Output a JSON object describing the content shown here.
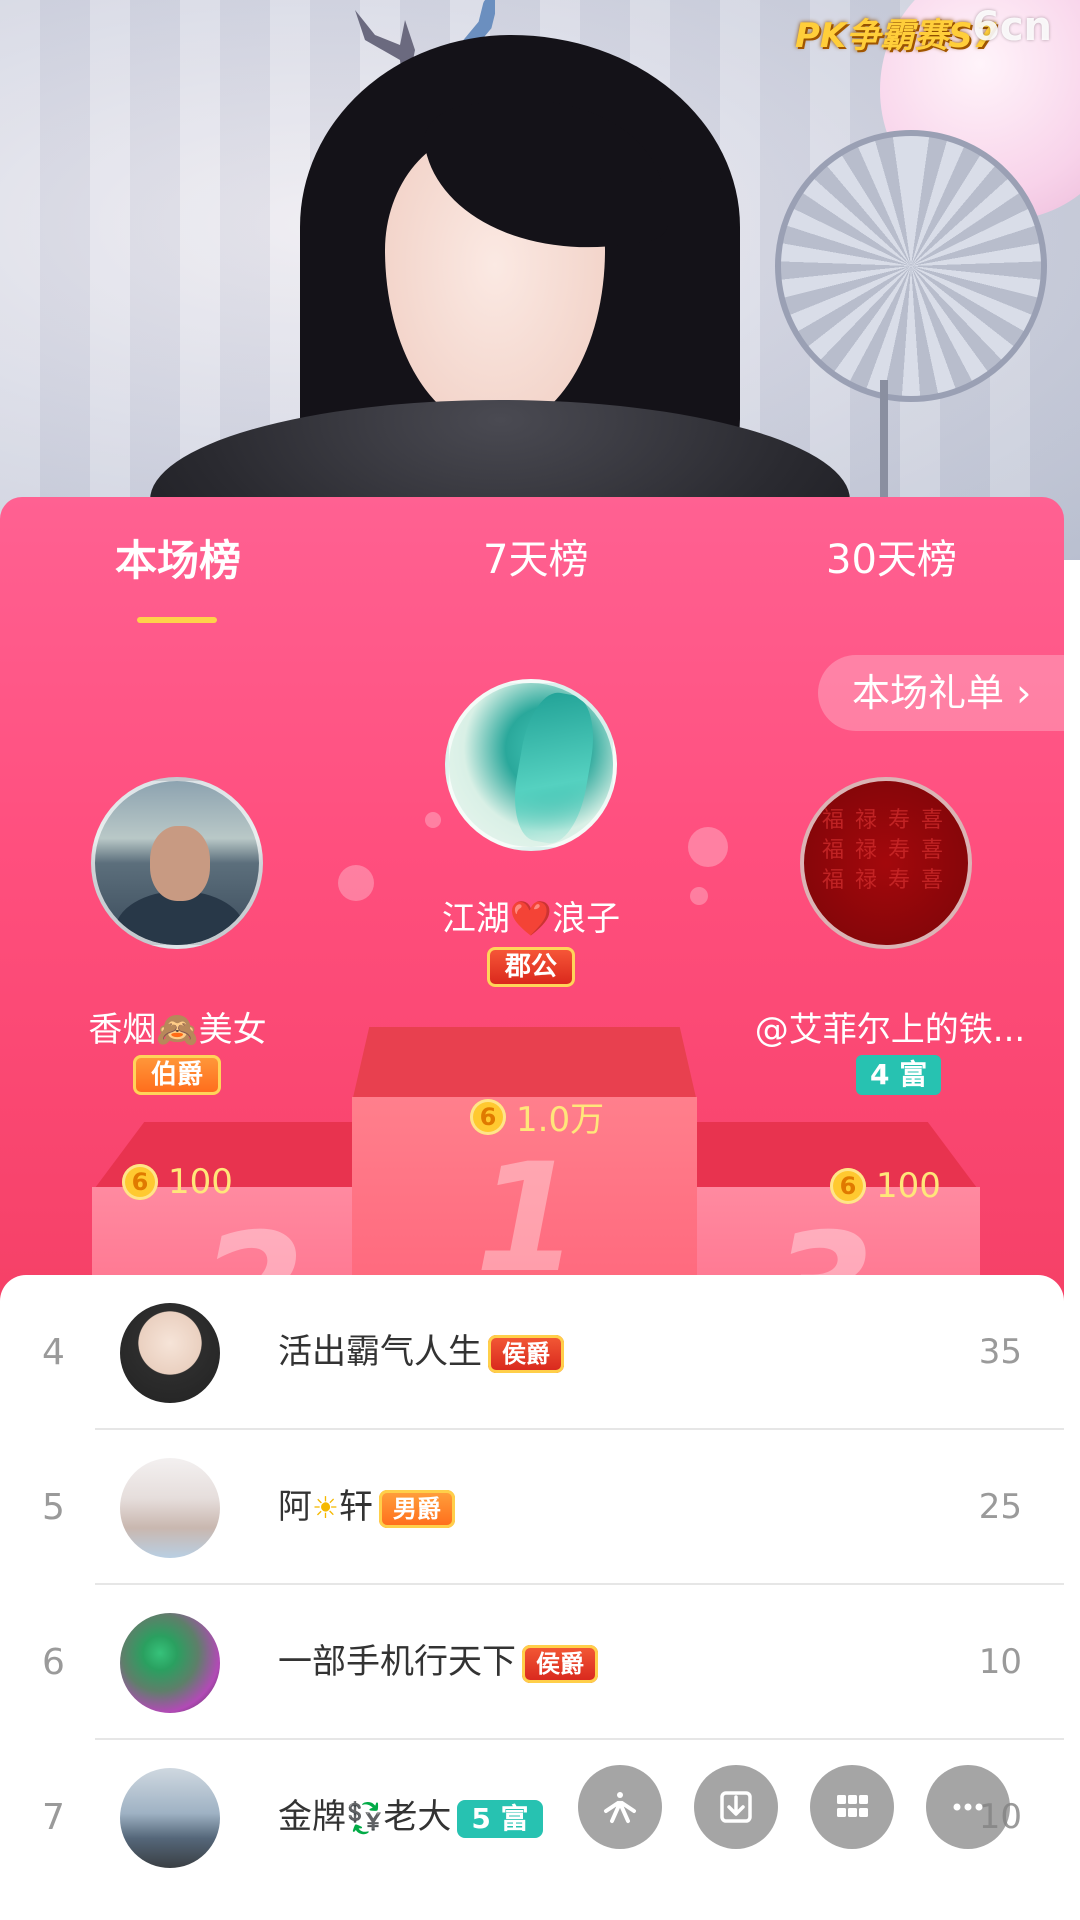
{
  "video": {
    "logo_event": "PK争霸赛S7",
    "logo_brand": "6cn"
  },
  "tabs": [
    {
      "label": "本场榜",
      "active": true
    },
    {
      "label": "7天榜",
      "active": false
    },
    {
      "label": "30天榜",
      "active": false
    }
  ],
  "gift_list_button": "本场礼单 ›",
  "podium": {
    "first": {
      "name": "江湖❤️浪子",
      "badge": "郡公",
      "amount": "1.0万",
      "rank_mark": "1"
    },
    "second": {
      "name": "香烟🙈美女",
      "badge": "伯爵",
      "amount": "100",
      "rank_mark": "2"
    },
    "third": {
      "name": "@艾菲尔上的铁...",
      "badge": "4 富",
      "amount": "100",
      "rank_mark": "3"
    }
  },
  "coin_symbol": "6",
  "list": [
    {
      "rank": "4",
      "name": "活出霸气人生",
      "badge": "侯爵",
      "badge_style": "red",
      "score": "35"
    },
    {
      "rank": "5",
      "name_a": "阿",
      "name_emoji": "☀",
      "name_b": "轩",
      "badge": "男爵",
      "badge_style": "orange",
      "score": "25"
    },
    {
      "rank": "6",
      "name": "一部手机行天下",
      "badge": "侯爵",
      "badge_style": "red",
      "score": "10"
    },
    {
      "rank": "7",
      "name_a": "金牌",
      "name_emoji": "💱",
      "name_b": "老大",
      "badge": "5 富",
      "badge_style": "rich",
      "score": "10"
    }
  ],
  "fab_icons": [
    "share-icon",
    "download-icon",
    "grid-icon",
    "more-icon"
  ],
  "colors": {
    "panel_pink": "#ff4f7e",
    "tab_underline": "#ffd24a",
    "amount_yellow": "#ffe67a",
    "rich_badge": "#27c2b1"
  }
}
